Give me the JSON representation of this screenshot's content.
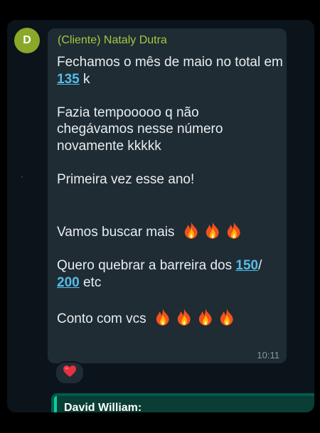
{
  "chat": {
    "sender_initial": "D",
    "sender_name": "(Cliente) Nataly Dutra",
    "message": {
      "line1_before": "Fechamos o mês de maio no total",
      "line2_before": "em",
      "link_135": "135",
      "line2_after": "k",
      "para2_line1": "Fazia tempooooo q não",
      "para2_line2": "chegávamos nesse número",
      "para2_line3": "novamente kkkkk",
      "para3": "Primeira vez esse ano!",
      "para4": "Vamos buscar mais",
      "para5_before": "Quero quebrar a barreira dos",
      "link_150": "150",
      "slash": "/",
      "link_200": "200",
      "para5_after": "etc",
      "para6": "Conto com vcs"
    },
    "time": "10:11",
    "reaction_icon": "heart-emoji",
    "next_message": {
      "quoted_name": "David William:"
    }
  },
  "colors": {
    "background": "#0b141a",
    "bubble_incoming": "#1f2c33",
    "bubble_outgoing": "#005c4b",
    "sender_name": "#a3c943",
    "link": "#53bdeb",
    "text": "#e9edef",
    "timestamp": "#8696a0",
    "avatar": "#8aa829"
  }
}
